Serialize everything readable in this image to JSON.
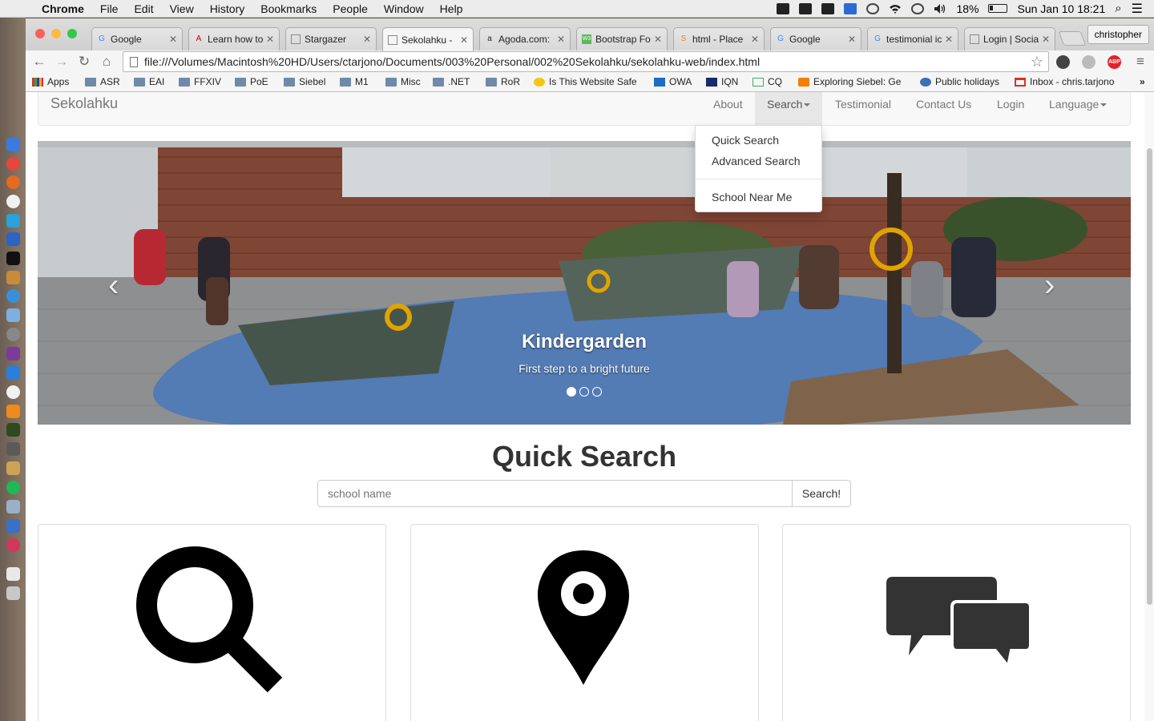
{
  "menubar": {
    "app": "Chrome",
    "items": [
      "File",
      "Edit",
      "View",
      "History",
      "Bookmarks",
      "People",
      "Window",
      "Help"
    ],
    "battery": "18%",
    "clock": "Sun Jan 10  18:21"
  },
  "tabs": [
    {
      "title": "Google",
      "favicon": "G"
    },
    {
      "title": "Learn how to",
      "favicon": "A"
    },
    {
      "title": "Stargazer",
      "favicon": ""
    },
    {
      "title": "Sekolahku - ",
      "favicon": ""
    },
    {
      "title": "Agoda.com:",
      "favicon": "a"
    },
    {
      "title": "Bootstrap Fo",
      "favicon": "W3"
    },
    {
      "title": "html - Place",
      "favicon": "S"
    },
    {
      "title": "Google",
      "favicon": "G"
    },
    {
      "title": "testimonial ic",
      "favicon": "G"
    },
    {
      "title": "Login | Social",
      "favicon": ""
    }
  ],
  "profile": "christopher",
  "address_bar": "file:///Volumes/Macintosh%20HD/Users/ctarjono/Documents/003%20Personal/002%20Sekolahku/sekolahku-web/index.html",
  "bookmarks": [
    "Apps",
    "ASR",
    "EAI",
    "FFXIV",
    "PoE",
    "Siebel",
    "M1",
    "Misc",
    ".NET",
    "RoR",
    "Is This Website Safe",
    "OWA",
    "IQN",
    "CQ",
    "Exploring Siebel: Ge",
    "Public holidays",
    "Inbox - chris.tarjono"
  ],
  "navbar": {
    "brand": "Sekolahku",
    "links": {
      "about": "About",
      "search": "Search",
      "testimonial": "Testimonial",
      "contact": "Contact Us",
      "login": "Login",
      "language": "Language"
    }
  },
  "search_dropdown": {
    "quick": "Quick Search",
    "advanced": "Advanced Search",
    "near": "School Near Me"
  },
  "carousel": {
    "caption_title": "Kindergarden",
    "caption_text": "First step to a bright future",
    "slide_count": 3,
    "active_slide": 1
  },
  "quick_search": {
    "heading": "Quick Search",
    "placeholder": "school name",
    "button": "Search!"
  },
  "feature_panels": [
    {
      "icon": "magnifier-icon"
    },
    {
      "icon": "map-pin-icon"
    },
    {
      "icon": "speech-bubbles-icon"
    }
  ]
}
